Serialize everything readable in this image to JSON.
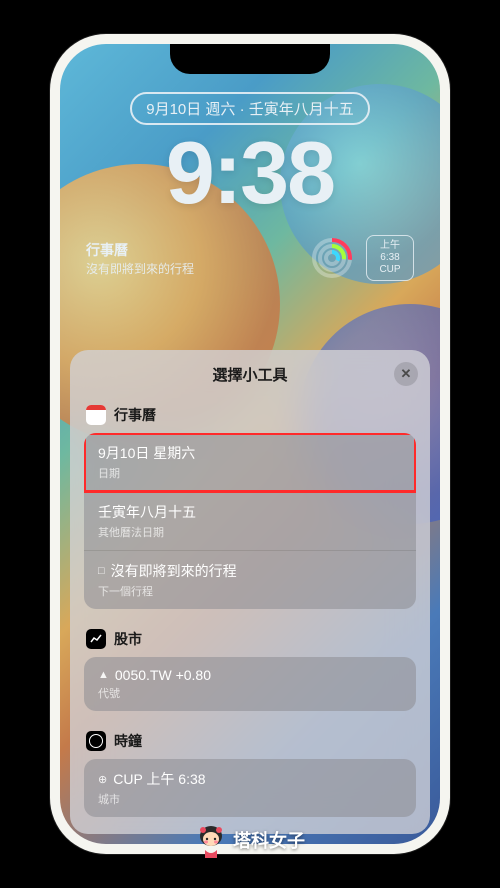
{
  "lockscreen": {
    "date_pill": "9月10日 週六 · 壬寅年八月十五",
    "time": "9:38",
    "calendar_widget": {
      "title": "行事曆",
      "subtitle": "沒有即將到來的行程"
    },
    "clock_widget": {
      "line1": "上午",
      "line2": "6:38",
      "line3": "CUP"
    }
  },
  "sheet": {
    "title": "選擇小工具",
    "close_glyph": "✕",
    "sections": [
      {
        "key": "calendar",
        "title": "行事曆",
        "items": [
          {
            "title": "9月10日 星期六",
            "subtitle": "日期",
            "highlighted": true
          },
          {
            "title": "壬寅年八月十五",
            "subtitle": "其他曆法日期"
          },
          {
            "icon": "□",
            "title": "沒有即將到來的行程",
            "subtitle": "下一個行程"
          }
        ]
      },
      {
        "key": "stocks",
        "title": "股市",
        "items": [
          {
            "icon": "▲",
            "title": "0050.TW +0.80",
            "subtitle": "代號"
          }
        ]
      },
      {
        "key": "clock",
        "title": "時鐘",
        "items": [
          {
            "icon": "⊕",
            "title": "CUP 上午 6:38",
            "subtitle": "城市"
          }
        ]
      }
    ]
  },
  "watermark": "塔科女子"
}
